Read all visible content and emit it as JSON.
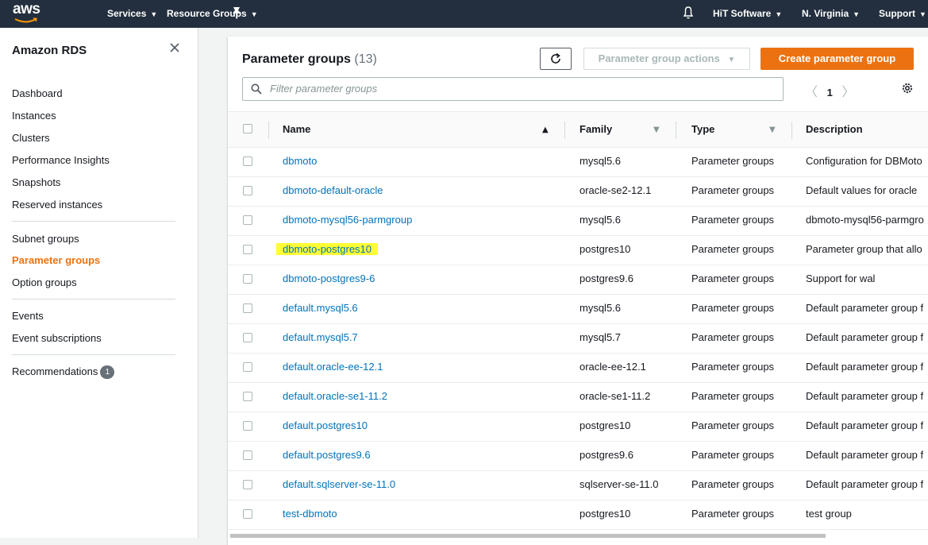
{
  "topnav": {
    "logo_text": "aws",
    "services": "Services",
    "resource_groups": "Resource Groups",
    "account": "HiT Software",
    "region": "N. Virginia",
    "support": "Support"
  },
  "sidebar": {
    "title": "Amazon RDS",
    "items": [
      {
        "label": "Dashboard"
      },
      {
        "label": "Instances"
      },
      {
        "label": "Clusters"
      },
      {
        "label": "Performance Insights"
      },
      {
        "label": "Snapshots"
      },
      {
        "label": "Reserved instances"
      },
      {
        "label": "Subnet groups"
      },
      {
        "label": "Parameter groups"
      },
      {
        "label": "Option groups"
      },
      {
        "label": "Events"
      },
      {
        "label": "Event subscriptions"
      },
      {
        "label": "Recommendations",
        "badge": "1"
      }
    ],
    "active_item": "Parameter groups"
  },
  "main": {
    "title": "Parameter groups",
    "count": "(13)",
    "actions_label": "Parameter group actions",
    "create_label": "Create parameter group",
    "filter_placeholder": "Filter parameter groups",
    "page_number": "1",
    "columns": [
      "Name",
      "Family",
      "Type",
      "Description"
    ],
    "rows": [
      {
        "name": "dbmoto",
        "family": "mysql5.6",
        "type": "Parameter groups",
        "description": "Configuration for DBMoto"
      },
      {
        "name": "dbmoto-default-oracle",
        "family": "oracle-se2-12.1",
        "type": "Parameter groups",
        "description": "Default values for oracle"
      },
      {
        "name": "dbmoto-mysql56-parmgroup",
        "family": "mysql5.6",
        "type": "Parameter groups",
        "description": "dbmoto-mysql56-parmgro"
      },
      {
        "name": "dbmoto-postgres10",
        "family": "postgres10",
        "type": "Parameter groups",
        "description": "Parameter group that allo",
        "highlighted": true
      },
      {
        "name": "dbmoto-postgres9-6",
        "family": "postgres9.6",
        "type": "Parameter groups",
        "description": "Support for wal"
      },
      {
        "name": "default.mysql5.6",
        "family": "mysql5.6",
        "type": "Parameter groups",
        "description": "Default parameter group f"
      },
      {
        "name": "default.mysql5.7",
        "family": "mysql5.7",
        "type": "Parameter groups",
        "description": "Default parameter group f"
      },
      {
        "name": "default.oracle-ee-12.1",
        "family": "oracle-ee-12.1",
        "type": "Parameter groups",
        "description": "Default parameter group f"
      },
      {
        "name": "default.oracle-se1-11.2",
        "family": "oracle-se1-11.2",
        "type": "Parameter groups",
        "description": "Default parameter group f"
      },
      {
        "name": "default.postgres10",
        "family": "postgres10",
        "type": "Parameter groups",
        "description": "Default parameter group f"
      },
      {
        "name": "default.postgres9.6",
        "family": "postgres9.6",
        "type": "Parameter groups",
        "description": "Default parameter group f"
      },
      {
        "name": "default.sqlserver-se-11.0",
        "family": "sqlserver-se-11.0",
        "type": "Parameter groups",
        "description": "Default parameter group f"
      },
      {
        "name": "test-dbmoto",
        "family": "postgres10",
        "type": "Parameter groups",
        "description": "test group"
      }
    ]
  },
  "colors": {
    "nav_bg": "#232f3e",
    "accent": "#ec7211",
    "link": "#0073bb",
    "highlight": "#ffff33"
  }
}
